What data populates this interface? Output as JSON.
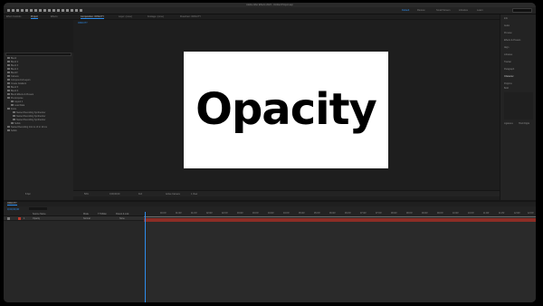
{
  "app": {
    "title": "Adobe After Effects 2023 - Untitled Project.aep"
  },
  "workspaces": [
    "Default",
    "Review",
    "Small Screen",
    "Libraries",
    "Learn"
  ],
  "search": {
    "placeholder": ""
  },
  "left_panel": {
    "tabs": [
      "Effect Controls",
      "Project",
      "Effects"
    ],
    "items": [
      "Blend",
      "Blend 2",
      "Blend 3",
      "Blend 4",
      "BlendV",
      "Camera",
      "Compos And Layers",
      "Create Gradient",
      "Blend 5",
      "Blend 6",
      "Blend Effects & Presets",
      "Precompose",
      "Layout 1",
      "Load Data",
      "Fonts",
      "Nested Recording Synthesizer",
      "Nested Recording Synthesizer",
      "Nested Recording Synthesizer",
      "Solids",
      "Nested Recording Intro to UI in 10 ms",
      "Solids"
    ],
    "bottom": [
      "8 bpc"
    ]
  },
  "comp_panel": {
    "tabs": [
      "Composition: OPACITY",
      "Layer: (none)",
      "Footage: (none)",
      "Flowchart: OPACITY"
    ],
    "breadcrumb": "OPACITY",
    "canvas_text": "Opacity"
  },
  "viewer_bar": {
    "zoom": "50%",
    "timecode": "0;00;00;00",
    "resolution": "Full",
    "camera": "Active Camera",
    "views": "1 View"
  },
  "right_panel": {
    "items": [
      "Info",
      "Audio",
      "Preview",
      "Effects & Presets",
      "Align",
      "Libraries",
      "Tracker",
      "Paragraph",
      "Character",
      "Poppins",
      "Bold"
    ],
    "bottom": [
      "Ligatures",
      "Hindi Digits"
    ]
  },
  "timeline": {
    "tab": "OPACITY",
    "timecode": "0;00;00;00",
    "columns": [
      "Source Name",
      "Mode",
      "T TrkMat",
      "Parent & Link"
    ],
    "layer": {
      "index": "1",
      "name": "Opacity",
      "mode": "Normal",
      "parent": "None"
    },
    "ruler": [
      "00:15f",
      "01:00f",
      "01:15f",
      "02:00f",
      "02:15f",
      "03:00f",
      "03:15f",
      "04:00f",
      "04:15f",
      "05:00f",
      "05:15f",
      "06:00f",
      "06:15f",
      "07:00f",
      "07:15f",
      "08:00f",
      "08:15f",
      "09:00f",
      "09:15f",
      "10:00f",
      "10:15f",
      "11:00f",
      "11:15f",
      "12:00f",
      "12:15f"
    ]
  }
}
